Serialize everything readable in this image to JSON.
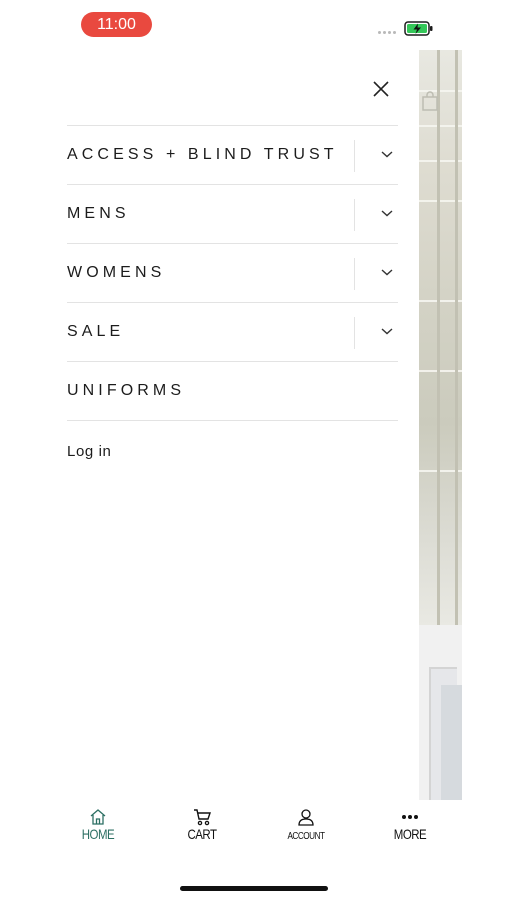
{
  "status_bar": {
    "time": "11:00",
    "time_pill_color": "#e9493f",
    "battery_icon": "battery-charging-icon",
    "battery_color": "#34c759"
  },
  "drawer": {
    "close_icon": "close-icon",
    "menu_items": [
      {
        "label": "ACCESS + BLIND TRUST",
        "expandable": true,
        "icon": "chevron-down-icon"
      },
      {
        "label": "MENS",
        "expandable": true,
        "icon": "chevron-down-icon"
      },
      {
        "label": "WOMENS",
        "expandable": true,
        "icon": "chevron-down-icon"
      },
      {
        "label": "SALE",
        "expandable": true,
        "icon": "chevron-down-icon"
      },
      {
        "label": "UNIFORMS",
        "expandable": false
      }
    ],
    "login_label": "Log in"
  },
  "tab_bar": {
    "accent_color": "#2c6f63",
    "tabs": [
      {
        "label": "HOME",
        "icon": "home-icon",
        "active": true
      },
      {
        "label": "CART",
        "icon": "cart-icon",
        "active": false
      },
      {
        "label": "ACCOUNT",
        "icon": "account-icon",
        "active": false
      },
      {
        "label": "MORE",
        "icon": "more-icon",
        "active": false
      }
    ]
  }
}
